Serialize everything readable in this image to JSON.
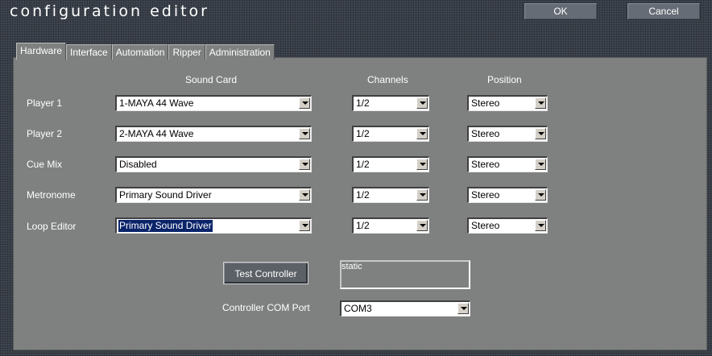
{
  "window": {
    "title": "configuration editor",
    "ok_label": "OK",
    "cancel_label": "Cancel"
  },
  "tabs": [
    {
      "label": "Hardware",
      "active": true
    },
    {
      "label": "Interface",
      "active": false
    },
    {
      "label": "Automation",
      "active": false
    },
    {
      "label": "Ripper",
      "active": false
    },
    {
      "label": "Administration",
      "active": false
    }
  ],
  "columns": {
    "sound_card": "Sound Card",
    "channels": "Channels",
    "position": "Position"
  },
  "rows": [
    {
      "label": "Player 1",
      "sound_card": "1-MAYA 44 Wave",
      "channels": "1/2",
      "position": "Stereo"
    },
    {
      "label": "Player 2",
      "sound_card": "2-MAYA 44 Wave",
      "channels": "1/2",
      "position": "Stereo"
    },
    {
      "label": "Cue Mix",
      "sound_card": "Disabled",
      "channels": "1/2",
      "position": "Stereo"
    },
    {
      "label": "Metronome",
      "sound_card": "Primary Sound Driver",
      "channels": "1/2",
      "position": "Stereo"
    },
    {
      "label": "Loop Editor",
      "sound_card": "Primary Sound Driver",
      "channels": "1/2",
      "position": "Stereo",
      "focused": true
    }
  ],
  "controller": {
    "test_button_label": "Test Controller",
    "status_text": "static",
    "com_port_label": "Controller COM Port",
    "com_port_value": "COM3"
  },
  "colors": {
    "window_bg": "#3f4650",
    "panel_bg": "#7e817f",
    "selection": "#0a246a"
  }
}
